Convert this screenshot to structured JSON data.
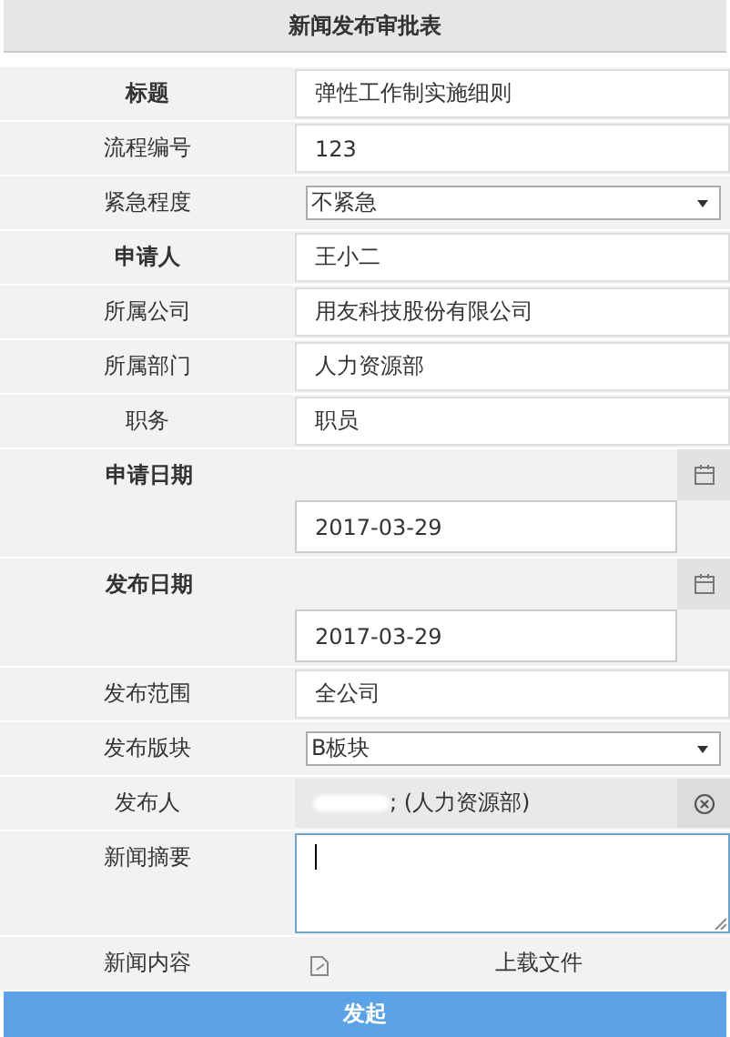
{
  "header": {
    "title": "新闻发布审批表"
  },
  "fields": [
    {
      "kind": "text",
      "label": "标题",
      "required": true,
      "value": "弹性工作制实施细则"
    },
    {
      "kind": "text",
      "label": "流程编号",
      "required": false,
      "value": "123"
    },
    {
      "kind": "select",
      "label": "紧急程度",
      "required": false,
      "value": "不紧急"
    },
    {
      "kind": "text",
      "label": "申请人",
      "required": true,
      "value": "王小二"
    },
    {
      "kind": "text",
      "label": "所属公司",
      "required": false,
      "value": "用友科技股份有限公司"
    },
    {
      "kind": "text",
      "label": "所属部门",
      "required": false,
      "value": "人力资源部"
    },
    {
      "kind": "text",
      "label": "职务",
      "required": false,
      "value": "职员"
    },
    {
      "kind": "date",
      "label": "申请日期",
      "required": true,
      "value": "2017-03-29"
    },
    {
      "kind": "date",
      "label": "发布日期",
      "required": true,
      "value": "2017-03-29"
    },
    {
      "kind": "text",
      "label": "发布范围",
      "required": false,
      "value": "全公司"
    },
    {
      "kind": "select",
      "label": "发布版块",
      "required": false,
      "value": "B板块"
    },
    {
      "kind": "person",
      "label": "发布人",
      "required": false,
      "value": "; (人力资源部)"
    },
    {
      "kind": "textarea",
      "label": "新闻摘要",
      "required": false,
      "focused": true
    },
    {
      "kind": "upload",
      "label": "新闻内容",
      "required": false,
      "button": "上载文件"
    }
  ],
  "submit": {
    "label": "发起"
  }
}
